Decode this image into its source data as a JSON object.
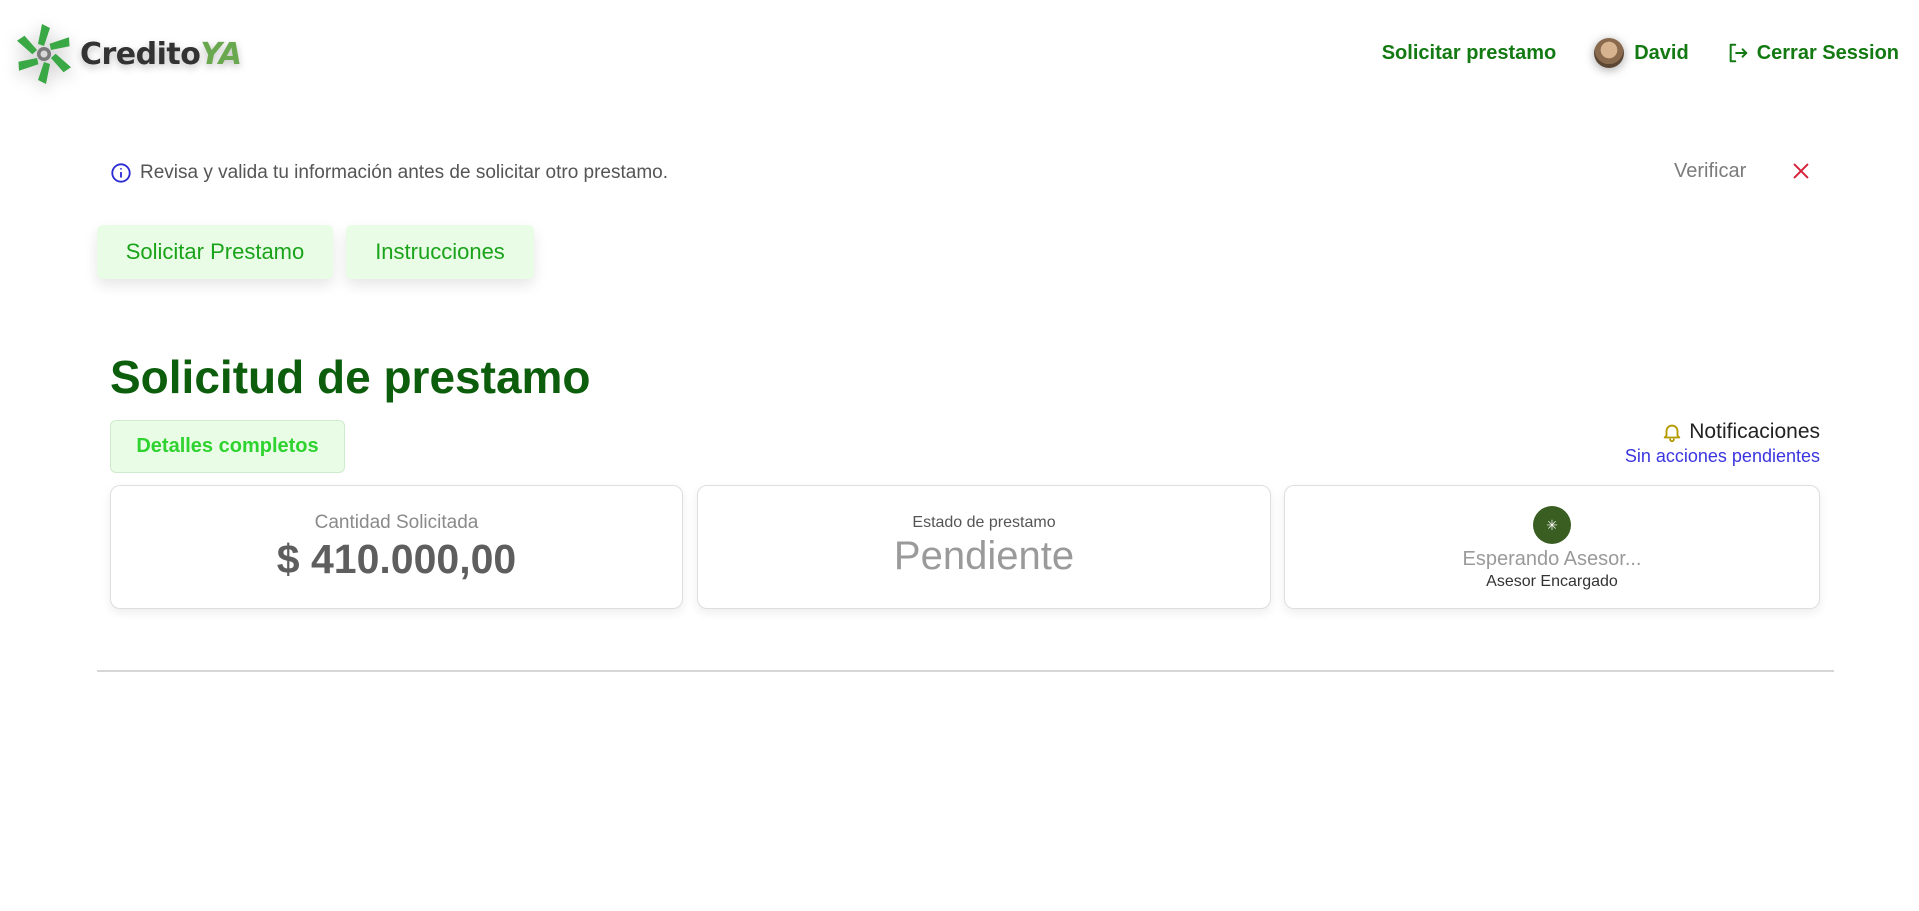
{
  "header": {
    "logo": {
      "part1": "Credito",
      "part2": "YA"
    },
    "nav": {
      "request_label": "Solicitar prestamo",
      "user_name": "David",
      "logout_label": "Cerrar Session"
    }
  },
  "alert": {
    "message": "Revisa y valida tu información antes de solicitar otro prestamo.",
    "verify_label": "Verificar"
  },
  "tabs": [
    {
      "label": "Solicitar Prestamo"
    },
    {
      "label": "Instrucciones"
    }
  ],
  "main": {
    "title": "Solicitud de prestamo",
    "details_label": "Detalles completos",
    "notifications": {
      "title": "Notificaciones",
      "subtitle": "Sin acciones pendientes"
    },
    "cards": {
      "amount": {
        "label": "Cantidad Solicitada",
        "value": "$ 410.000,00"
      },
      "status": {
        "label": "Estado de prestamo",
        "value": "Pendiente"
      },
      "advisor": {
        "name": "Esperando Asesor...",
        "role": "Asesor Encargado"
      }
    }
  },
  "colors": {
    "brand_dark": "#0c5e0c",
    "brand_link": "#137a13",
    "tab_bg": "#e9fde6",
    "accent_green": "#2fd32f",
    "notif_link": "#3a35e0",
    "close_red": "#d6223a"
  },
  "icons": {
    "logo": "pinwheel-logo-icon",
    "logout": "logout-icon",
    "info": "info-circle-icon",
    "close": "close-icon",
    "bell": "bell-icon",
    "advisor": "advisor-badge-icon"
  }
}
